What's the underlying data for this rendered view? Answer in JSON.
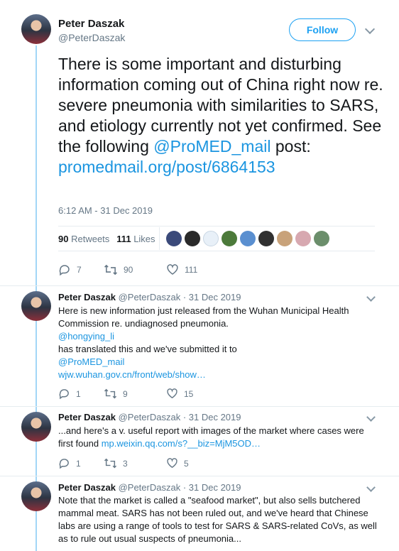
{
  "main_tweet": {
    "name": "Peter Daszak",
    "handle": "@PeterDaszak",
    "follow_label": "Follow",
    "text_before": "There is some important and disturbing information coming out of China right now re. severe pneumonia with similarities to SARS, and etiology currently not yet confirmed. See the following ",
    "mention": "@ProMED_mail",
    "text_after": " post:",
    "url": "promedmail.org/post/6864153",
    "timestamp": "6:12 AM - 31 Dec 2019",
    "retweets_count": "90",
    "retweets_label": "Retweets",
    "likes_count": "111",
    "likes_label": "Likes",
    "reply_count": "7",
    "retweet_count": "90",
    "like_count": "111"
  },
  "replies": [
    {
      "name": "Peter Daszak",
      "handle": "@PeterDaszak",
      "date": "· 31 Dec 2019",
      "line1": "Here is new information just released from the Wuhan Municipal Health Commission re. undiagnosed pneumonia.",
      "mention1": "@hongying_li",
      "line2": " has translated this and we've submitted it to",
      "mention2": "@ProMED_mail",
      "link": "wjw.wuhan.gov.cn/front/web/show…",
      "reply_count": "1",
      "retweet_count": "9",
      "like_count": "15"
    },
    {
      "name": "Peter Daszak",
      "handle": "@PeterDaszak",
      "date": "· 31 Dec 2019",
      "text": "...and here's a v. useful report with images of the market where cases were first found ",
      "link": "mp.weixin.qq.com/s?__biz=MjM5OD…",
      "reply_count": "1",
      "retweet_count": "3",
      "like_count": "5"
    },
    {
      "name": "Peter Daszak",
      "handle": "@PeterDaszak",
      "date": "· 31 Dec 2019",
      "text": "Note that the market is called a \"seafood market\", but also sells butchered mammal meat.  SARS has not been ruled out, and we've heard that Chinese labs are using a range of tools to test for SARS & SARS-related CoVs, as well as to rule out usual suspects of pneumonia..."
    }
  ],
  "colors": {
    "accent": "#1da1f2",
    "link": "#1b95e0",
    "muted": "#657786",
    "thread": "#a2d6f7"
  },
  "icons": [
    "reply-icon",
    "retweet-icon",
    "like-icon",
    "chevron-down-icon",
    "avatar"
  ]
}
